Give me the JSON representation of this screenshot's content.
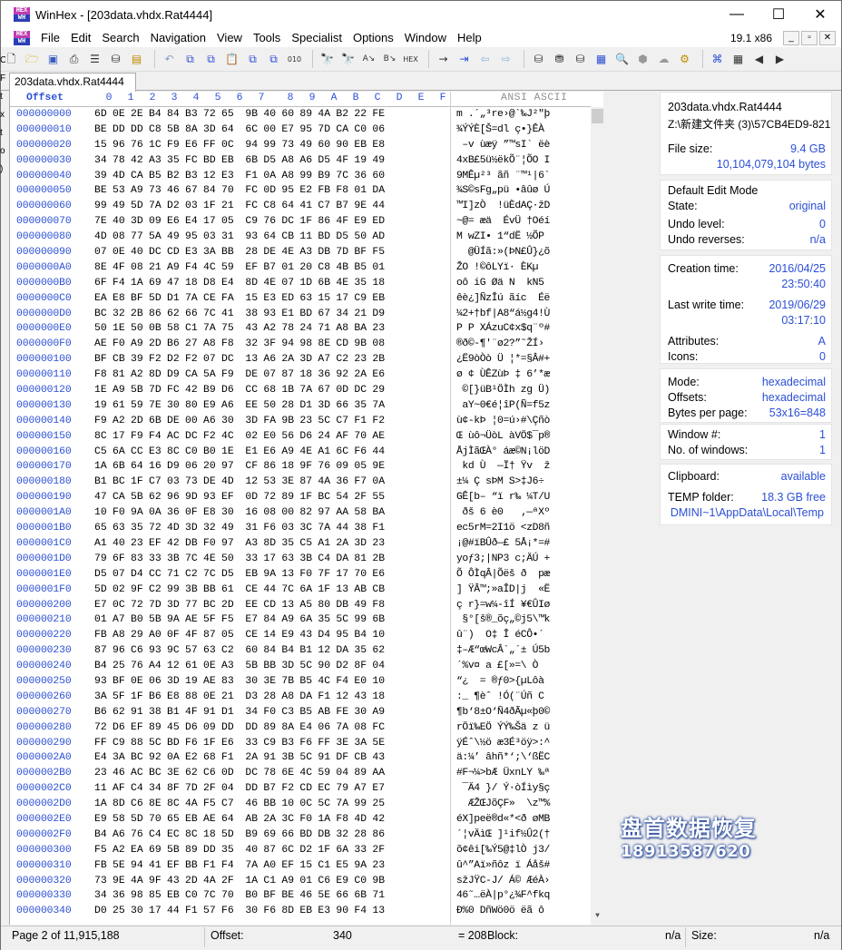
{
  "window": {
    "title": "WinHex - [203data.vhdx.Rat4444]",
    "min": "—",
    "max": "☐",
    "close": "✕"
  },
  "menu": {
    "items": [
      "File",
      "Edit",
      "Search",
      "Navigation",
      "View",
      "Tools",
      "Specialist",
      "Options",
      "Window",
      "Help"
    ],
    "zoom": "19.1 x86",
    "mdi": [
      "_",
      "▫",
      "✕"
    ]
  },
  "tab": {
    "label": "203data.vhdx.Rat4444"
  },
  "hex": {
    "offset_header": "Offset",
    "columns": [
      "0",
      "1",
      "2",
      "3",
      "4",
      "5",
      "6",
      "7",
      "8",
      "9",
      "A",
      "B",
      "C",
      "D",
      "E",
      "F"
    ],
    "ansi_header": "ANSI ASCII",
    "rows": [
      {
        "off": "000000000",
        "bytes": "6D 0E 2E B4 84 B3 72 65  9B 40 60 89 4A B2 22 FE",
        "ansi": "m .´„³re›@`‰J²\"þ"
      },
      {
        "off": "000000010",
        "bytes": "BE DD DD C8 5B 8A 3D 64  6C 00 E7 95 7D CA C0 06",
        "ansi": "¾ÝÝÈ[Š=dl ç•}ÊÀ "
      },
      {
        "off": "000000020",
        "bytes": "15 96 76 1C F9 E6 FF 0C  94 99 73 49 60 90 EB E8",
        "ansi": " –v ùæÿ ”™sI` ëè"
      },
      {
        "off": "000000030",
        "bytes": "34 78 42 A3 35 FC BD EB  6B D5 A8 A6 D5 4F 19 49",
        "ansi": "4xB£5ü½ëkÕ¨¦ÕO I"
      },
      {
        "off": "000000040",
        "bytes": "39 4D CA B5 B2 B3 12 E3  F1 0A A8 99 B9 7C 36 60",
        "ansi": "9MÊµ²³ ãñ ¨™¹|6`"
      },
      {
        "off": "000000050",
        "bytes": "BE 53 A9 73 46 67 84 70  FC 0D 95 E2 FB F8 01 DA",
        "ansi": "¾S©sFg„pü •âûø Ú"
      },
      {
        "off": "000000060",
        "bytes": "99 49 5D 7A D2 03 1F 21  FC C8 64 41 C7 B7 9E 44",
        "ansi": "™I]zÒ  !üÈdAÇ·žD"
      },
      {
        "off": "000000070",
        "bytes": "7E 40 3D 09 E6 E4 17 05  C9 76 DC 1F 86 4F E9 ED",
        "ansi": "~@= æä  ÉvÜ †Oéí"
      },
      {
        "off": "000000080",
        "bytes": "4D 08 77 5A 49 95 03 31  93 64 CB 11 BD D5 50 AD",
        "ansi": "M wZI• 1“dË ½ÕP­"
      },
      {
        "off": "000000090",
        "bytes": "07 0E 40 DC CD E3 3A BB  28 DE 4E A3 DB 7D BF F5",
        "ansi": "  @ÜÍã:»(ÞN£Û}¿õ"
      },
      {
        "off": "0000000A0",
        "bytes": "8E 4F 08 21 A9 F4 4C 59  EF B7 01 20 C8 4B B5 01",
        "ansi": "ŽO !©ôLYï· ÈKµ "
      },
      {
        "off": "0000000B0",
        "bytes": "6F F4 1A 69 47 18 D8 E4  8D 4E 07 1D 6B 4E 35 18",
        "ansi": "oô iG Øä N  kN5 "
      },
      {
        "off": "0000000C0",
        "bytes": "EA E8 BF 5D D1 7A CE FA  15 E3 ED 63 15 17 C9 EB",
        "ansi": "êè¿]ÑzÎú ãíc  Éë"
      },
      {
        "off": "0000000D0",
        "bytes": "BC 32 2B 86 62 66 7C 41  38 93 E1 BD 67 34 21 D9",
        "ansi": "¼2+†bf|A8“á½g4!Ù"
      },
      {
        "off": "0000000E0",
        "bytes": "50 1E 50 0B 58 C1 7A 75  43 A2 78 24 71 A8 BA 23",
        "ansi": "P P XÁzuC¢x$q¨º#"
      },
      {
        "off": "0000000F0",
        "bytes": "AE F0 A9 2D B6 27 A8 F8  32 3F 94 98 8E CD 9B 08",
        "ansi": "®ð©-¶'¨ø2?”˜ŽÍ› "
      },
      {
        "off": "000000100",
        "bytes": "BF CB 39 F2 D2 F2 07 DC  13 A6 2A 3D A7 C2 23 2B",
        "ansi": "¿Ë9òÒò Ü ¦*=§Â#+"
      },
      {
        "off": "000000110",
        "bytes": "F8 81 A2 8D D9 CA 5A F9  DE 07 87 18 36 92 2A E6",
        "ansi": "ø ¢ ÙÊZùÞ ‡ 6’*æ"
      },
      {
        "off": "000000120",
        "bytes": "1E A9 5B 7D FC 42 B9 D6  CC 68 1B 7A 67 0D DC 29",
        "ansi": " ©[}üB¹ÖÌh zg Ü)"
      },
      {
        "off": "000000130",
        "bytes": "19 61 59 7E 30 80 E9 A6  EE 50 28 D1 3D 66 35 7A",
        "ansi": " aY~0€é¦îP(Ñ=f5z"
      },
      {
        "off": "000000140",
        "bytes": "F9 A2 2D 6B DE 00 A6 30  3D FA 9B 23 5C C7 F1 F2",
        "ansi": "ù¢-kÞ ¦0=ú›#\\Çñò"
      },
      {
        "off": "000000150",
        "bytes": "8C 17 F9 F4 AC DC F2 4C  02 E0 56 D6 24 AF 70 AE",
        "ansi": "Œ ùô¬ÜòL àVÖ$¯p®"
      },
      {
        "off": "000000160",
        "bytes": "C5 6A CC E3 8C C0 B0 1E  E1 E6 A9 4E A1 6C F6 44",
        "ansi": "ÅjÌãŒÀ° áæ©N¡löD"
      },
      {
        "off": "000000170",
        "bytes": "1A 6B 64 16 D9 06 20 97  CF 86 18 9F 76 09 05 9E",
        "ansi": " kd Ù  —Ï† Ÿv  ž"
      },
      {
        "off": "000000180",
        "bytes": "B1 BC 1F C7 03 73 DE 4D  12 53 3E 87 4A 36 F7 0A",
        "ansi": "±¼ Ç sÞM S>‡J6÷ "
      },
      {
        "off": "000000190",
        "bytes": "47 CA 5B 62 96 9D 93 EF  0D 72 89 1F BC 54 2F 55",
        "ansi": "GÊ[b– “ï r‰ ¼T/U"
      },
      {
        "off": "0000001A0",
        "bytes": "10 F0 9A 0A 36 0F E8 30  16 08 00 82 97 AA 58 BA",
        "ansi": " ðš 6 è0   ‚—ªXº"
      },
      {
        "off": "0000001B0",
        "bytes": "65 63 35 72 4D 3D 32 49  31 F6 03 3C 7A 44 38 F1",
        "ansi": "ec5rM=2I1ö <zD8ñ"
      },
      {
        "off": "0000001C0",
        "bytes": "A1 40 23 EF 42 DB F0 97  A3 8D 35 C5 A1 2A 3D 23",
        "ansi": "¡@#ïBÛð—£ 5Å¡*=#"
      },
      {
        "off": "0000001D0",
        "bytes": "79 6F 83 33 3B 7C 4E 50  33 17 63 3B C4 DA 81 2B",
        "ansi": "yoƒ3;|NP3 c;ÄÚ +"
      },
      {
        "off": "0000001E0",
        "bytes": "D5 07 D4 CC 71 C2 7C D5  EB 9A 13 F0 7F 17 70 E6",
        "ansi": "Õ ÔÌqÂ|Õëš ð  pæ"
      },
      {
        "off": "0000001F0",
        "bytes": "5D 02 9F C2 99 3B BB 61  CE 44 7C 6A 1F 13 AB CB",
        "ansi": "] ŸÂ™;»aÎD|j  «Ë"
      },
      {
        "off": "000000200",
        "bytes": "E7 0C 72 7D 3D 77 BC 2D  EE CD 13 A5 80 DB 49 F8",
        "ansi": "ç r}=w¼-îÍ ¥€ÛIø"
      },
      {
        "off": "000000210",
        "bytes": "01 A7 B0 5B 9A AE 5F F5  E7 84 A9 6A 35 5C 99 6B",
        "ansi": " §°[š®_õç„©j5\\™k"
      },
      {
        "off": "000000220",
        "bytes": "FB A8 29 A0 0F 4F 87 05  CE 14 E9 43 D4 95 B4 10",
        "ansi": "û¨)  O‡ Î éCÔ•´ "
      },
      {
        "off": "000000230",
        "bytes": "87 96 C6 93 9C 57 63 C2  60 84 B4 B1 12 DA 35 62",
        "ansi": "‡–Æ“œWcÂ`„´± Ú5b"
      },
      {
        "off": "000000240",
        "bytes": "B4 25 76 A4 12 61 0E A3  5B BB 3D 5C 90 D2 8F 04",
        "ansi": "´%v¤ a £[»=\\ Ò  "
      },
      {
        "off": "000000250",
        "bytes": "93 BF 0E 06 3D 19 AE 83  30 3E 7B B5 4C F4 E0 10",
        "ansi": "“¿  = ®ƒ0>{µLôà "
      },
      {
        "off": "000000260",
        "bytes": "3A 5F 1F B6 E8 88 0E 21  D3 28 A8 DA F1 12 43 18",
        "ansi": ":_ ¶èˆ !Ó(¨Úñ C "
      },
      {
        "off": "000000270",
        "bytes": "B6 62 91 38 B1 4F 91 D1  34 F0 C3 B5 AB FE 30 A9",
        "ansi": "¶b‘8±O‘Ñ4ðÃµ«þ0©"
      },
      {
        "off": "000000280",
        "bytes": "72 D6 EF 89 45 D6 09 DD  DD 89 8A E4 06 7A 08 FC",
        "ansi": "rÖï‰EÖ ÝÝ‰Šä z ü"
      },
      {
        "off": "000000290",
        "bytes": "FF C9 88 5C BD F6 1F E6  33 C9 B3 F6 FF 3E 3A 5E",
        "ansi": "ÿÉˆ\\½ö æ3É³öÿ>:^"
      },
      {
        "off": "0000002A0",
        "bytes": "E4 3A BC 92 0A E2 68 F1  2A 91 3B 5C 91 DF CB 43",
        "ansi": "ä:¼’ âhñ*‘;\\‘ßËC"
      },
      {
        "off": "0000002B0",
        "bytes": "23 46 AC BC 3E 62 C6 0D  DC 78 6E 4C 59 04 89 AA",
        "ansi": "#F¬¼>bÆ ÜxnLY ‰ª"
      },
      {
        "off": "0000002C0",
        "bytes": "11 AF C4 34 8F 7D 2F 04  DD B7 F2 CD EC 79 A7 E7",
        "ansi": " ¯Ä4 }/ Ý·òÍìy§ç"
      },
      {
        "off": "0000002D0",
        "bytes": "1A 8D C6 8E 8C 4A F5 C7  46 BB 10 0C 5C 7A 99 25",
        "ansi": "  ÆŽŒJõÇF»  \\z™%"
      },
      {
        "off": "0000002E0",
        "bytes": "E9 58 5D 70 65 EB AE 64  AB 2A 3C F0 1A F8 4D 42",
        "ansi": "éX]peë®d«*<ð øMB"
      },
      {
        "off": "0000002F0",
        "bytes": "B4 A6 76 C4 EC 8C 18 5D  B9 69 66 BD DB 32 28 86",
        "ansi": "´¦vÄìŒ ]¹if½Û2(†"
      },
      {
        "off": "000000300",
        "bytes": "F5 A2 EA 69 5B 89 DD 35  40 87 6C D2 1F 6A 33 2F",
        "ansi": "õ¢êi[‰Ý5@‡lÒ j3/"
      },
      {
        "off": "000000310",
        "bytes": "FB 5E 94 41 EF BB F1 F4  7A A0 EF 15 C1 E5 9A 23",
        "ansi": "û^”Aï»ñôz ï Áåš#"
      },
      {
        "off": "000000320",
        "bytes": "73 9E 4A 9F 43 2D 4A 2F  1A C1 A9 01 C6 E9 C0 9B",
        "ansi": "sžJŸC-J/ Á© ÆéÀ›"
      },
      {
        "off": "000000330",
        "bytes": "34 36 98 85 EB C0 7C 70  B0 BF BE 46 5E 66 6B 71",
        "ansi": "46˜…ëÀ|p°¿¾F^fkq"
      },
      {
        "off": "000000340",
        "bytes": "D0 25 30 17 44 F1 57 F6  30 F6 8D EB E3 90 F4 13",
        "ansi": "Ð%0 DñWö0ö ëã ô "
      }
    ]
  },
  "side": {
    "filename": "203data.vhdx.Rat4444",
    "path": "Z:\\新建文件夹 (3)\\57CB4ED9-821",
    "filesize_label": "File size:",
    "filesize_gb": "9.4 GB",
    "filesize_bytes": "10,104,079,104 bytes",
    "edit_mode_title": "Default Edit Mode",
    "state_label": "State:",
    "state": "original",
    "undo_level_label": "Undo level:",
    "undo_level": "0",
    "undo_rev_label": "Undo reverses:",
    "undo_rev": "n/a",
    "ctime_label": "Creation time:",
    "ctime_date": "2016/04/25",
    "ctime_time": "23:50:40",
    "wtime_label": "Last write time:",
    "wtime_date": "2019/06/29",
    "wtime_time": "03:17:10",
    "attr_label": "Attributes:",
    "attr": "A",
    "icons_label": "Icons:",
    "icons": "0",
    "mode_label": "Mode:",
    "mode": "hexadecimal",
    "offsets_label": "Offsets:",
    "offsets": "hexadecimal",
    "bpp_label": "Bytes per page:",
    "bpp": "53x16=848",
    "winno_label": "Window #:",
    "winno": "1",
    "nwin_label": "No. of windows:",
    "nwin": "1",
    "clip_label": "Clipboard:",
    "clip": "available",
    "temp_label": "TEMP folder:",
    "temp_free": "18.3 GB free",
    "temp_path": "DMINI~1\\AppData\\Local\\Temp"
  },
  "status": {
    "page": "Page 2 of 11,915,188",
    "offset_label": "Offset:",
    "offset": "340",
    "value": "= 208",
    "block_label": "Block:",
    "block": "n/a",
    "size_label": "Size:",
    "size": "n/a"
  },
  "watermark": {
    "line1": "盘首数据恢复",
    "line2": "18913587620"
  },
  "colors": {
    "accent": "#2b4fd6",
    "ansi_header": "#8f8f8f"
  }
}
